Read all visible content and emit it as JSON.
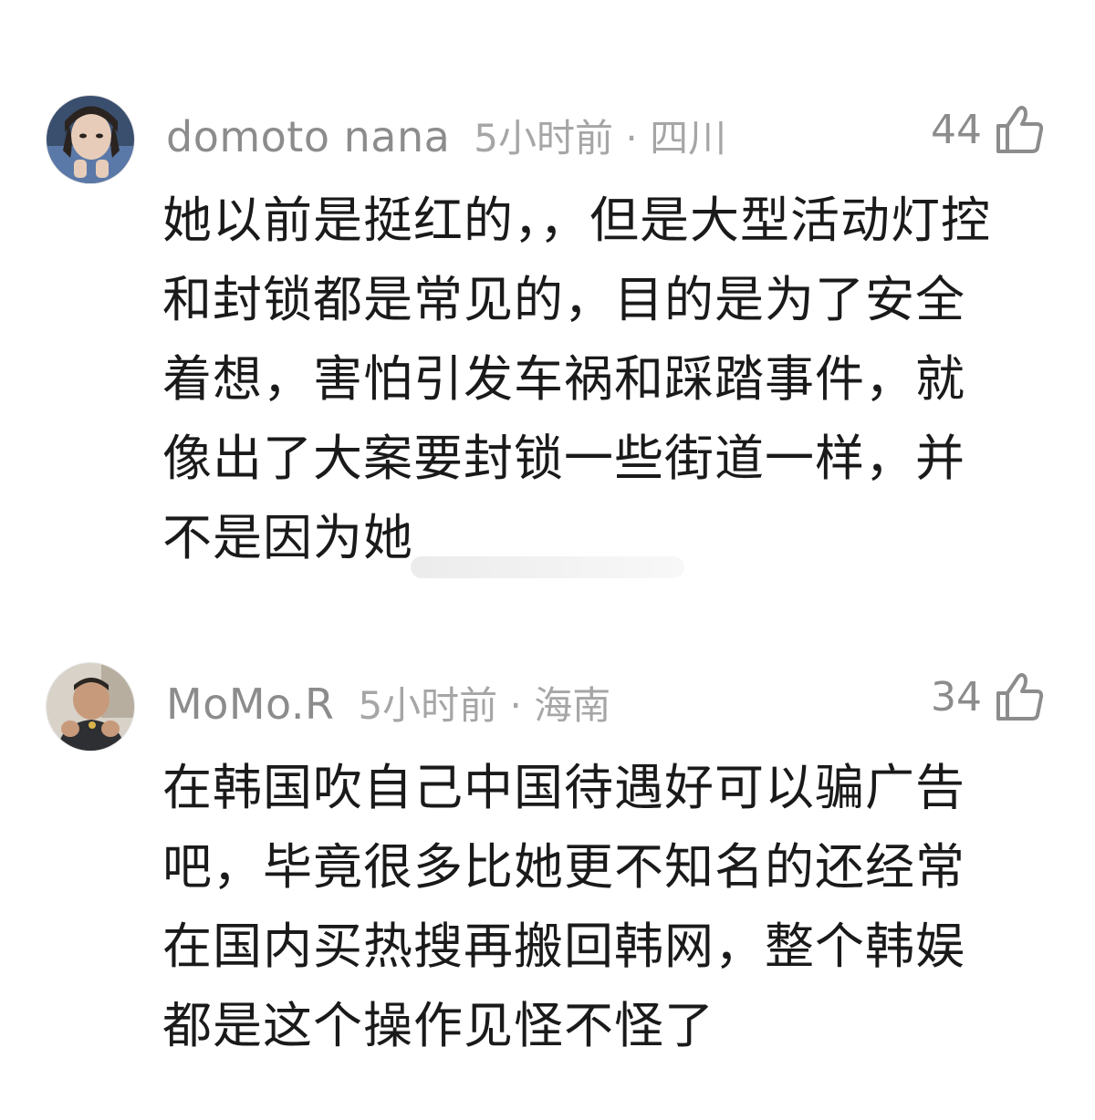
{
  "comments": [
    {
      "username": "domoto nana",
      "time_location": "5小时前 · 四川",
      "likes": "44",
      "content": "她以前是挺红的，，但是大型活动灯控和封锁都是常见的，目的是为了安全着想，害怕引发车祸和踩踏事件，就像出了大案要封锁一些街道一样，并不是因为她",
      "avatar_icon": "user-avatar-icon",
      "like_icon": "thumbs-up-icon"
    },
    {
      "username": "MoMo.R",
      "time_location": "5小时前 · 海南",
      "likes": "34",
      "content": "在韩国吹自己中国待遇好可以骗广告吧，毕竟很多比她更不知名的还经常在国内买热搜再搬回韩网，整个韩娱都是这个操作见怪不怪了",
      "avatar_icon": "user-avatar-icon",
      "like_icon": "thumbs-up-icon"
    }
  ],
  "colors": {
    "username": "#8c8c8c",
    "meta": "#a6a6a6",
    "text": "#1a1a1a",
    "background": "#ffffff"
  }
}
